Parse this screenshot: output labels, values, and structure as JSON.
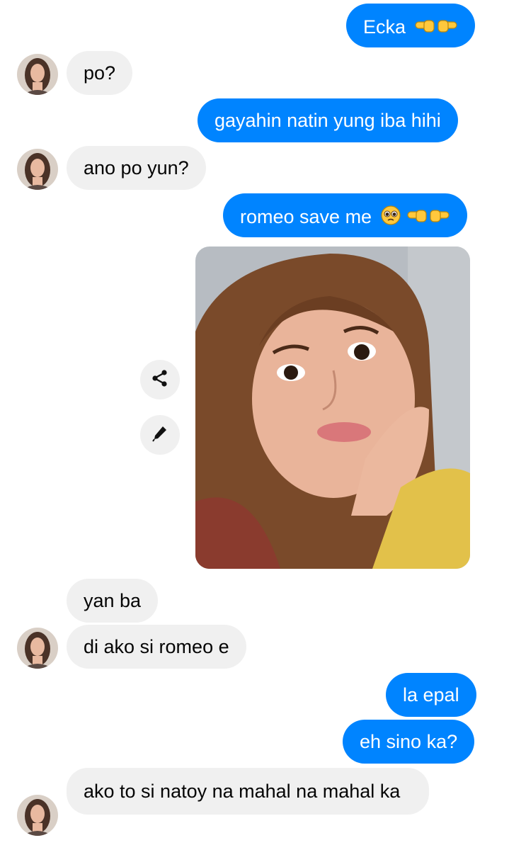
{
  "messages": [
    {
      "text": "Ecka"
    },
    {
      "text": "po?"
    },
    {
      "text": "gayahin natin yung iba hihi"
    },
    {
      "text": "ano po yun?"
    },
    {
      "text": "romeo save me"
    },
    {
      "text": "yan ba"
    },
    {
      "text": "di ako si romeo e"
    },
    {
      "text": "la epal"
    },
    {
      "text": "eh sino ka?"
    },
    {
      "text": "ako to si natoy na mahal na mahal ka"
    }
  ],
  "photo_actions": {
    "share_icon": "share-icon",
    "edit_icon": "pencil-icon"
  },
  "colors": {
    "outgoing_bubble": "#0084ff",
    "incoming_bubble": "#f0f0f0",
    "outgoing_text": "#ffffff",
    "incoming_text": "#050505"
  }
}
